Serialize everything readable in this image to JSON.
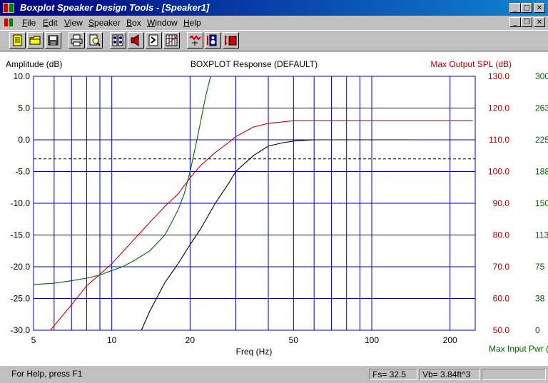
{
  "window": {
    "title": "Boxplot Speaker Design Tools - [Speaker1]",
    "buttons": {
      "minimize": "_",
      "maximize": "□",
      "close": "✕",
      "restore": "❐"
    }
  },
  "menu": [
    {
      "label": "File",
      "u": "F",
      "rest": "ile"
    },
    {
      "label": "Edit",
      "u": "E",
      "rest": "dit"
    },
    {
      "label": "View",
      "u": "V",
      "rest": "iew"
    },
    {
      "label": "Speaker",
      "u": "S",
      "rest": "peaker"
    },
    {
      "label": "Box",
      "u": "B",
      "rest": "ox"
    },
    {
      "label": "Window",
      "u": "W",
      "rest": "indow"
    },
    {
      "label": "Help",
      "u": "H",
      "rest": "elp"
    }
  ],
  "toolbar": {
    "icons": [
      "new-file-icon",
      "open-folder-icon",
      "save-disk-icon",
      "print-icon",
      "print-preview-icon",
      "speaker-parameters-icon",
      "speaker-icon",
      "box-icon",
      "chart-grid-icon",
      "response-curve-icon",
      "excursion-icon",
      "spl-icon"
    ]
  },
  "chart_data": {
    "type": "line",
    "title": "BOXPLOT Response (DEFAULT)",
    "xlabel": "Freq (Hz)",
    "ylabel": "Amplitude (dB)",
    "y2label": "Max Output SPL (dB)",
    "y3label": "Max Input Pwr (W",
    "xscale": "log",
    "xlim": [
      5,
      250
    ],
    "ylim": [
      -30,
      10
    ],
    "x_tick_labels": [
      {
        "x": 5,
        "label": "5"
      },
      {
        "x": 10,
        "label": "10"
      },
      {
        "x": 20,
        "label": "20"
      },
      {
        "x": 50,
        "label": "50"
      },
      {
        "x": 100,
        "label": "100"
      },
      {
        "x": 200,
        "label": "200"
      }
    ],
    "x_gridlines": [
      6,
      7,
      8,
      9,
      10,
      20,
      30,
      40,
      50,
      60,
      70,
      80,
      90,
      100,
      200
    ],
    "y_ticks": [
      10,
      5,
      0,
      -5,
      -10,
      -15,
      -20,
      -25,
      -30
    ],
    "y_tick_labels": [
      "10.0",
      "5.0",
      "0.0",
      "-5.0",
      "-10.0",
      "-15.0",
      "-20.0",
      "-25.0",
      "-30.0"
    ],
    "y2_tick_labels": [
      "130.0",
      "120.0",
      "110.0",
      "100.0",
      "90.0",
      "80.0",
      "70.0",
      "60.0",
      "50.0"
    ],
    "y3_tick_labels": [
      "300",
      "263",
      "225",
      "188",
      "150",
      "113",
      "75",
      "38",
      "0"
    ],
    "reference_line_y": -3,
    "series": [
      {
        "color": "#000000",
        "points": [
          [
            13,
            -30
          ],
          [
            14,
            -27
          ],
          [
            16,
            -22.5
          ],
          [
            18,
            -19.5
          ],
          [
            20,
            -16.5
          ],
          [
            22,
            -14
          ],
          [
            25,
            -10
          ],
          [
            28,
            -7
          ],
          [
            30,
            -5
          ],
          [
            35,
            -2.5
          ],
          [
            40,
            -1
          ],
          [
            45,
            -0.5
          ],
          [
            50,
            -0.2
          ],
          [
            60,
            0
          ],
          [
            80,
            0
          ],
          [
            100,
            0
          ],
          [
            140,
            0
          ]
        ]
      },
      {
        "color": "#cc0000",
        "points": [
          [
            5.8,
            -30
          ],
          [
            7,
            -26
          ],
          [
            8,
            -23
          ],
          [
            9,
            -21.2
          ],
          [
            10,
            -19.5
          ],
          [
            12,
            -16
          ],
          [
            14,
            -13
          ],
          [
            16,
            -10.5
          ],
          [
            18,
            -8.5
          ],
          [
            20,
            -6
          ],
          [
            22,
            -4
          ],
          [
            25,
            -2
          ],
          [
            28,
            -0.5
          ],
          [
            30,
            0.5
          ],
          [
            35,
            2
          ],
          [
            40,
            2.6
          ],
          [
            50,
            3
          ],
          [
            80,
            3
          ],
          [
            100,
            3
          ],
          [
            200,
            3
          ],
          [
            245,
            3
          ]
        ]
      },
      {
        "color": "#006600",
        "points": [
          [
            5,
            -22.8
          ],
          [
            6,
            -22.6
          ],
          [
            7,
            -22.2
          ],
          [
            8,
            -21.8
          ],
          [
            9,
            -21.3
          ],
          [
            10,
            -20.6
          ],
          [
            11,
            -20
          ],
          [
            12,
            -19.2
          ],
          [
            14,
            -17.5
          ],
          [
            16,
            -15
          ],
          [
            17,
            -13
          ],
          [
            18,
            -11
          ],
          [
            19,
            -8.5
          ],
          [
            20,
            -5
          ],
          [
            21,
            -1
          ],
          [
            22,
            3
          ],
          [
            23,
            7
          ],
          [
            24,
            10
          ]
        ]
      }
    ]
  },
  "status": {
    "help": "For Help, press F1",
    "fs": "Fs= 32.5",
    "vb": "Vb=  3.84ft^3",
    "extra": ""
  }
}
